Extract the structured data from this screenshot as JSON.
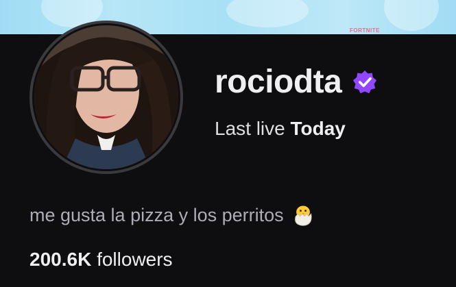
{
  "banner": {
    "tag_text": "FORTNITE"
  },
  "profile": {
    "username": "rociodta",
    "last_live_label": "Last live",
    "last_live_value": "Today",
    "bio": "me gusta la pizza y los perritos",
    "followers_count": "200.6K",
    "followers_label": "followers"
  },
  "icons": {
    "verified": "verified-badge-icon",
    "bio_emoji": "hatching-chick-emoji"
  },
  "colors": {
    "background": "#0e0e10",
    "verified": "#9147ff",
    "banner": "#a8e0f5"
  }
}
